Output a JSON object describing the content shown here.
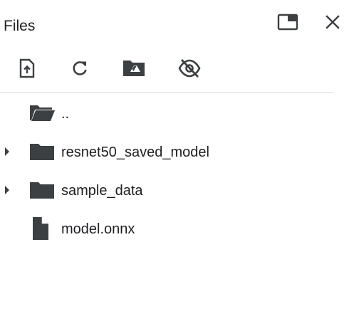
{
  "panel": {
    "title": "Files"
  },
  "header": {
    "buttons": [
      {
        "name": "maximize-panel-icon"
      },
      {
        "name": "close-icon"
      }
    ]
  },
  "toolbar": {
    "tools": [
      {
        "name": "upload-file-icon"
      },
      {
        "name": "refresh-icon"
      },
      {
        "name": "mount-drive-icon"
      },
      {
        "name": "hide-hidden-files-icon"
      }
    ]
  },
  "tree": {
    "items": [
      {
        "label": "..",
        "type": "parent-folder",
        "expandable": false
      },
      {
        "label": "resnet50_saved_model",
        "type": "folder",
        "expandable": true
      },
      {
        "label": "sample_data",
        "type": "folder",
        "expandable": true
      },
      {
        "label": "model.onnx",
        "type": "file",
        "expandable": false
      }
    ]
  },
  "colors": {
    "icon": "#3c4043",
    "text": "#202124",
    "divider": "#dadce0"
  }
}
